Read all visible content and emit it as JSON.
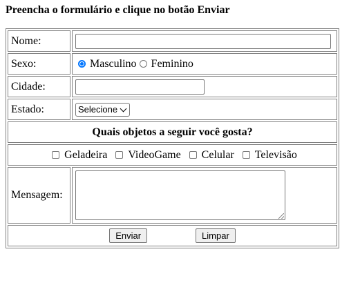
{
  "header": {
    "title": "Preencha o formulário e clique no botão Enviar"
  },
  "form": {
    "name_label": "Nome:",
    "name_value": "",
    "sex_label": "Sexo:",
    "sex_options": [
      "Masculino",
      "Feminino"
    ],
    "sex_selected": "Masculino",
    "city_label": "Cidade:",
    "city_value": "",
    "state_label": "Estado:",
    "state_selected": "Selecione",
    "objects_question": "Quais objetos a seguir você gosta?",
    "objects": [
      "Geladeira",
      "VideoGame",
      "Celular",
      "Televisão"
    ],
    "message_label": "Mensagem:",
    "message_value": "",
    "submit_label": "Enviar",
    "reset_label": "Limpar"
  }
}
